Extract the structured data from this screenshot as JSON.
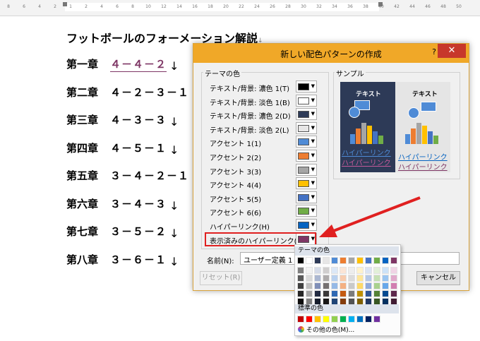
{
  "ruler": {
    "ticks": [
      "8",
      "6",
      "4",
      "2",
      "1",
      "2",
      "4",
      "6",
      "8",
      "10",
      "12",
      "14",
      "16",
      "18",
      "20",
      "22",
      "24",
      "26",
      "28",
      "30",
      "32",
      "34",
      "36",
      "38",
      "40",
      "42",
      "44",
      "46",
      "48",
      "50"
    ]
  },
  "document": {
    "title": "フットボールのフォーメーション解説",
    "paragraph_mark": "↓",
    "chapters": [
      {
        "label": "第一章",
        "value": "４－４－２",
        "styled": true
      },
      {
        "label": "第二章",
        "value": "４－２－３－１"
      },
      {
        "label": "第三章",
        "value": "４－３－３"
      },
      {
        "label": "第四章",
        "value": "４－５－１"
      },
      {
        "label": "第五章",
        "value": "３－４－２－１"
      },
      {
        "label": "第六章",
        "value": "３－４－３"
      },
      {
        "label": "第七章",
        "value": "３－５－２"
      },
      {
        "label": "第八章",
        "value": "３－６－１"
      }
    ]
  },
  "dialog": {
    "title": "新しい配色パターンの作成",
    "help": "?",
    "close": "✕",
    "theme_colors_caption": "テーマの色",
    "sample_caption": "サンプル",
    "rows": [
      {
        "label": "テキスト/背景: 濃色 1(T)",
        "color": "#000000"
      },
      {
        "label": "テキスト/背景: 淡色 1(B)",
        "color": "#FFFFFF"
      },
      {
        "label": "テキスト/背景: 濃色 2(D)",
        "color": "#2D3A57"
      },
      {
        "label": "テキスト/背景: 淡色 2(L)",
        "color": "#E7E6E6"
      },
      {
        "label": "アクセント 1(1)",
        "color": "#4F8BD6"
      },
      {
        "label": "アクセント 2(2)",
        "color": "#ED7D31"
      },
      {
        "label": "アクセント 3(3)",
        "color": "#A5A5A5"
      },
      {
        "label": "アクセント 4(4)",
        "color": "#FFC000"
      },
      {
        "label": "アクセント 5(5)",
        "color": "#4472C4"
      },
      {
        "label": "アクセント 6(6)",
        "color": "#70AD47"
      },
      {
        "label": "ハイパーリンク(H)",
        "color": "#0563C1"
      },
      {
        "label": "表示済みのハイパーリンク(F)",
        "color": "#7E3665"
      }
    ],
    "sample": {
      "text_label": "テキスト",
      "hyperlink": "ハイパーリンク",
      "visited": "ハイパーリンク",
      "bar_colors": [
        "#4F8BD6",
        "#ED7D31",
        "#A5A5A5",
        "#FFC000",
        "#4472C4",
        "#70AD47"
      ]
    },
    "name_label": "名前(N):",
    "name_value": "ユーザー定義 1",
    "reset_label": "リセット(R)",
    "cancel_label": "キャンセル"
  },
  "palette": {
    "theme_caption": "テーマの色",
    "standard_caption": "標準の色",
    "more_colors": "その他の色(M)...",
    "theme_columns": [
      [
        "#000000",
        "#7F7F7F",
        "#595959",
        "#404040",
        "#262626",
        "#0D0D0D"
      ],
      [
        "#FFFFFF",
        "#F2F2F2",
        "#D9D9D9",
        "#BFBFBF",
        "#A6A6A6",
        "#808080"
      ],
      [
        "#2D3A57",
        "#D5DBE8",
        "#ABB7D1",
        "#808FB8",
        "#222B42",
        "#161D2C"
      ],
      [
        "#E7E6E6",
        "#D0CECE",
        "#AEABAB",
        "#757171",
        "#3A3838",
        "#171616"
      ],
      [
        "#4F8BD6",
        "#DCE8F7",
        "#B9D1EF",
        "#95B9E6",
        "#2E68B3",
        "#1F4577"
      ],
      [
        "#ED7D31",
        "#FBE5D6",
        "#F8CBAD",
        "#F4B183",
        "#C55A11",
        "#843C0C"
      ],
      [
        "#A5A5A5",
        "#EDEDED",
        "#DBDBDB",
        "#C9C9C9",
        "#7B7B7B",
        "#525252"
      ],
      [
        "#FFC000",
        "#FFF2CC",
        "#FFE699",
        "#FFD966",
        "#BF9000",
        "#7F6000"
      ],
      [
        "#4472C4",
        "#DAE3F3",
        "#B4C7E7",
        "#8FAADC",
        "#2F5597",
        "#203864"
      ],
      [
        "#70AD47",
        "#E2F0D9",
        "#C5E0B4",
        "#A9D18E",
        "#548235",
        "#385723"
      ],
      [
        "#0563C1",
        "#CDE2F8",
        "#9BC5F1",
        "#69A8EA",
        "#044A91",
        "#023161"
      ],
      [
        "#7E3665",
        "#F0D4E5",
        "#E1A9CB",
        "#D27EB1",
        "#5E284C",
        "#3F1B32"
      ]
    ],
    "standard_colors": [
      "#C00000",
      "#FF0000",
      "#FFC000",
      "#FFFF00",
      "#92D050",
      "#00B050",
      "#00B0F0",
      "#0070C0",
      "#002060",
      "#7030A0"
    ]
  }
}
